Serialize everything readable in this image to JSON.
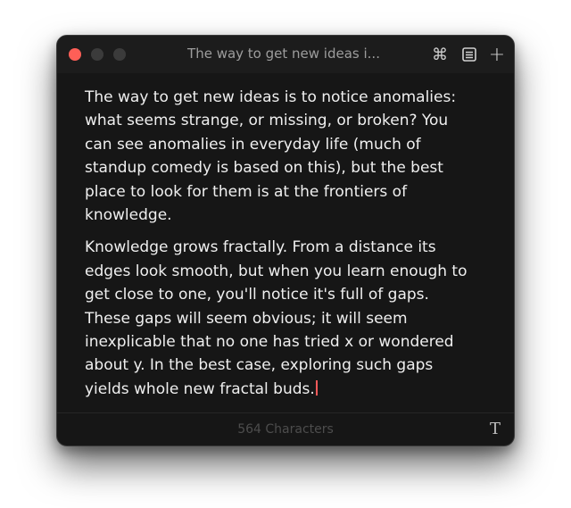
{
  "window": {
    "title": "The way to get new ideas i...",
    "icons": {
      "command": "⌘",
      "command_name": "command-icon",
      "document_name": "document-icon",
      "new": "+",
      "new_name": "plus-icon"
    }
  },
  "editor": {
    "paragraphs": [
      "The way to get new ideas is to notice anomalies: what seems strange, or missing, or broken? You can see anomalies in everyday life (much of standup comedy is based on this), but the best place to look for them is at the frontiers of knowledge.",
      "Knowledge grows fractally. From a distance its edges look smooth, but when you learn enough to get close to one, you'll notice it's full of gaps. These gaps will seem obvious; it will seem inexplicable that no one has tried x or wondered about y. In the best case, exploring such gaps yields whole new fractal buds."
    ]
  },
  "footer": {
    "char_count": "564 Characters",
    "font_button": "T"
  },
  "colors": {
    "close": "#ff5f57",
    "cursor": "#ff5a5a",
    "background": "#161616",
    "text": "#efefef"
  }
}
